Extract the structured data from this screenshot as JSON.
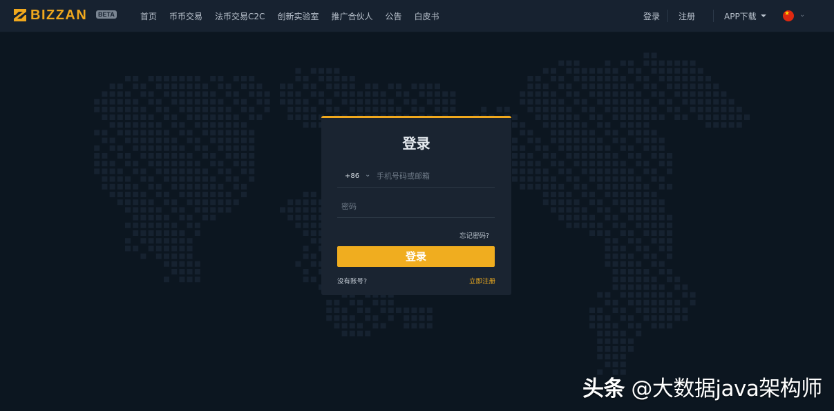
{
  "brand": {
    "name": "BIZZAN",
    "badge": "BETA"
  },
  "nav": [
    {
      "label": "首页"
    },
    {
      "label": "币币交易"
    },
    {
      "label": "法币交易C2C"
    },
    {
      "label": "创新实验室"
    },
    {
      "label": "推广合伙人"
    },
    {
      "label": "公告"
    },
    {
      "label": "白皮书"
    }
  ],
  "header_right": {
    "login": "登录",
    "register": "注册",
    "app_download": "APP下载",
    "language_flag": "china-flag-icon"
  },
  "login_form": {
    "title": "登录",
    "country_code": "+86",
    "account_placeholder": "手机号码或邮箱",
    "password_placeholder": "密码",
    "forgot": "忘记密码?",
    "submit": "登录",
    "no_account": "没有账号?",
    "register_now": "立即注册"
  },
  "watermark": {
    "source": "头条",
    "handle": "@大数据java架构师"
  },
  "colors": {
    "accent": "#f0ad1f",
    "background": "#0c1620",
    "header": "#172230",
    "card": "#1a2431",
    "map_dots": "#162230"
  }
}
